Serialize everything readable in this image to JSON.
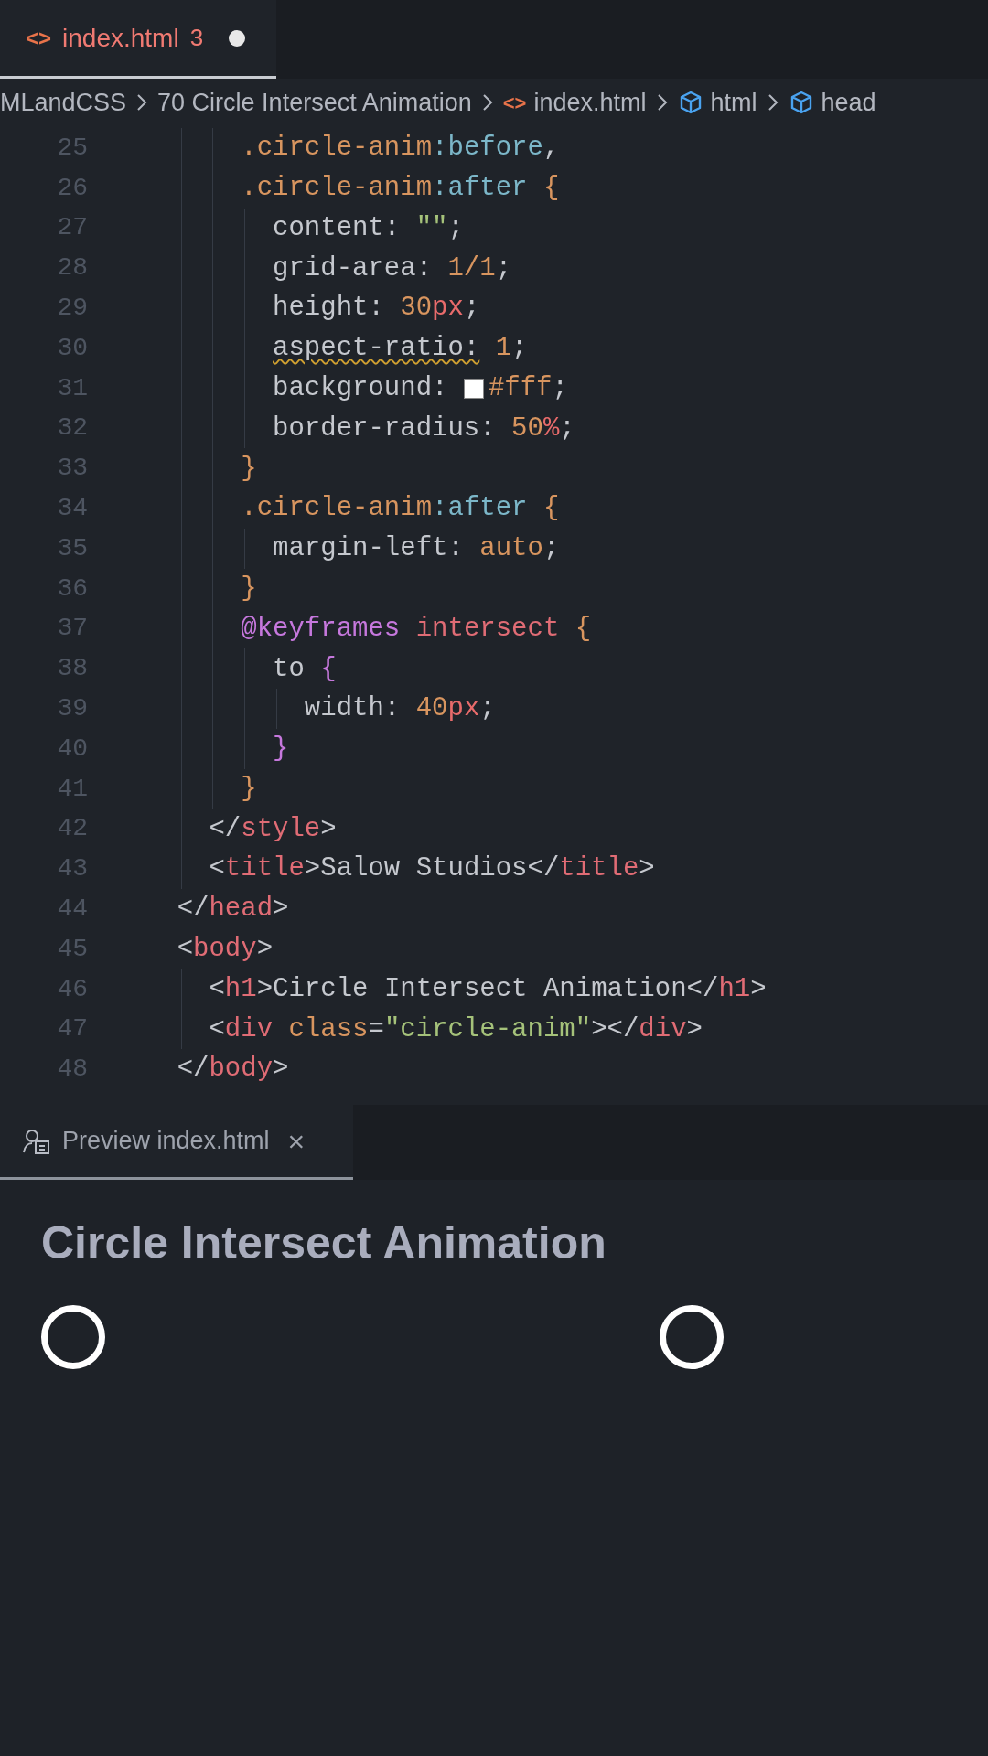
{
  "editor_tab": {
    "icon": "<>",
    "label": "index.html",
    "problems": "3",
    "modified": true,
    "selected": true
  },
  "breadcrumb": [
    {
      "label": "MLandCSS",
      "kind": "folder"
    },
    {
      "label": "70 Circle Intersect Animation",
      "kind": "folder"
    },
    {
      "label": "index.html",
      "kind": "file"
    },
    {
      "label": "html",
      "kind": "element"
    },
    {
      "label": "head",
      "kind": "element"
    }
  ],
  "code_lines": [
    {
      "number": "25",
      "text": "        .circle-anim:before,"
    },
    {
      "number": "26",
      "text": "        .circle-anim:after {"
    },
    {
      "number": "27",
      "text": "          content: \"\";"
    },
    {
      "number": "28",
      "text": "          grid-area: 1/1;"
    },
    {
      "number": "29",
      "text": "          height: 30px;"
    },
    {
      "number": "30",
      "text": "          aspect-ratio: 1;",
      "warning": true
    },
    {
      "number": "31",
      "text": "          background: #fff;",
      "swatch": true
    },
    {
      "number": "32",
      "text": "          border-radius: 50%;"
    },
    {
      "number": "33",
      "text": "        }"
    },
    {
      "number": "34",
      "text": "        .circle-anim:after {"
    },
    {
      "number": "35",
      "text": "          margin-left: auto;"
    },
    {
      "number": "36",
      "text": "        }"
    },
    {
      "number": "37",
      "text": "        @keyframes intersect {"
    },
    {
      "number": "38",
      "text": "          to {"
    },
    {
      "number": "39",
      "text": "            width: 40px;"
    },
    {
      "number": "40",
      "text": "          }"
    },
    {
      "number": "41",
      "text": "        }"
    },
    {
      "number": "42",
      "text": "      </style>"
    },
    {
      "number": "43",
      "text": "      <title>Salow Studios</title>"
    },
    {
      "number": "44",
      "text": "    </head>"
    },
    {
      "number": "45",
      "text": "    <body>"
    },
    {
      "number": "46",
      "text": "      <h1>Circle Intersect Animation</h1>"
    },
    {
      "number": "47",
      "text": "      <div class=\"circle-anim\"></div>"
    },
    {
      "number": "48",
      "text": "    </body>"
    }
  ],
  "preview_tab": {
    "label": "Preview index.html",
    "close": "×",
    "selected": true
  },
  "preview": {
    "heading": "Circle Intersect Animation"
  }
}
